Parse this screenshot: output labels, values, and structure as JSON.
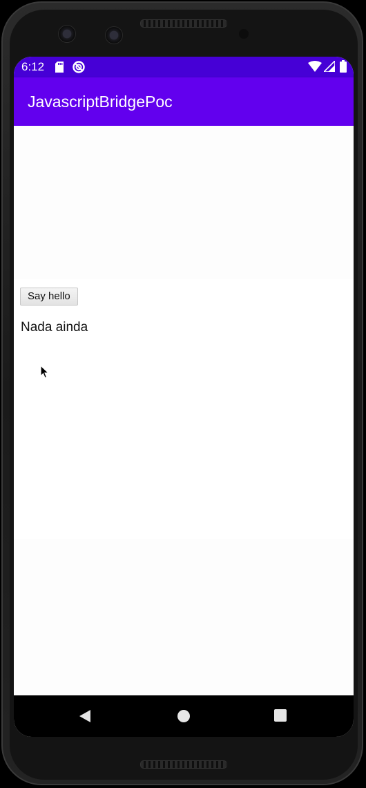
{
  "status_bar": {
    "time": "6:12",
    "left_icons": [
      "sd-card-icon",
      "do-not-disturb-icon"
    ],
    "right_icons": [
      "wifi-icon",
      "signal-icon",
      "battery-icon"
    ]
  },
  "app_bar": {
    "title": "JavascriptBridgePoc"
  },
  "web_content": {
    "button_label": "Say hello",
    "status_text": "Nada ainda"
  },
  "nav_bar": {
    "buttons": [
      "back-icon",
      "home-icon",
      "recents-icon"
    ]
  },
  "colors": {
    "status_bar": "#4600d6",
    "app_bar": "#6200ee",
    "background": "#ffffff"
  }
}
